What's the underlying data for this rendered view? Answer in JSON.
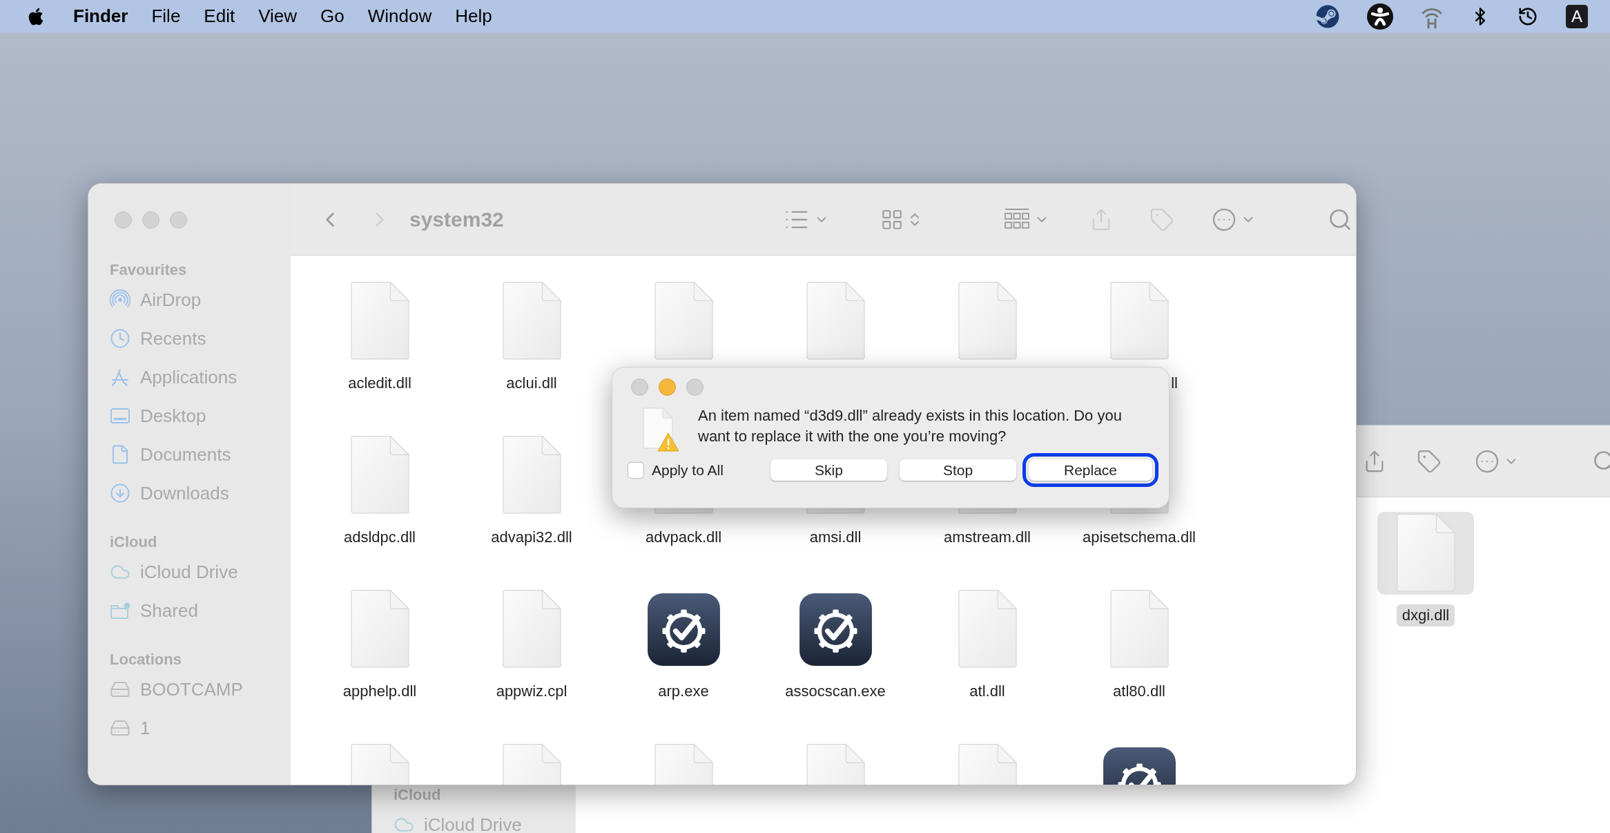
{
  "menu_bar": {
    "app_name": "Finder",
    "menus": [
      "File",
      "Edit",
      "View",
      "Go",
      "Window",
      "Help"
    ],
    "input_source": "A"
  },
  "back_window": {
    "sidebar": [
      {
        "heading": "iCloud",
        "items": [
          {
            "label": "iCloud Drive",
            "kind": "cloud",
            "selected": false
          }
        ]
      }
    ],
    "files": [
      {
        "label": "dxgi.dll",
        "kind": "document",
        "selected": true
      }
    ]
  },
  "finder_window": {
    "traffic_lights": [
      {
        "active": false
      },
      {
        "active": false
      },
      {
        "active": false
      }
    ],
    "back_enabled": true,
    "forward_enabled": false,
    "title": "system32",
    "sidebar": [
      {
        "heading": "Favourites",
        "items": [
          {
            "label": "AirDrop",
            "kind": "airdrop",
            "selected": false
          },
          {
            "label": "Recents",
            "kind": "clock",
            "selected": false
          },
          {
            "label": "Applications",
            "kind": "apps",
            "selected": false
          },
          {
            "label": "Desktop",
            "kind": "desktop",
            "selected": false
          },
          {
            "label": "Documents",
            "kind": "document",
            "selected": false
          },
          {
            "label": "Downloads",
            "kind": "download",
            "selected": false
          }
        ]
      },
      {
        "heading": "iCloud",
        "items": [
          {
            "label": "iCloud Drive",
            "kind": "cloud",
            "selected": false
          },
          {
            "label": "Shared",
            "kind": "shared",
            "selected": false
          }
        ]
      },
      {
        "heading": "Locations",
        "items": [
          {
            "label": "BOOTCAMP",
            "kind": "drive",
            "selected": false
          },
          {
            "label": "1",
            "kind": "drive",
            "selected": false
          }
        ]
      }
    ],
    "files": [
      {
        "label": "acledit.dll",
        "kind": "document",
        "selected": false
      },
      {
        "label": "aclui.dll",
        "kind": "document",
        "selected": false
      },
      {
        "kind": "document",
        "selected": false
      },
      {
        "kind": "document",
        "selected": false
      },
      {
        "kind": "document",
        "selected": false
      },
      {
        "label": "ll",
        "label_cut_left": true,
        "kind": "document",
        "selected": false
      },
      {
        "label": "adsldpc.dll",
        "kind": "document",
        "selected": false
      },
      {
        "label": "advapi32.dll",
        "kind": "document",
        "selected": false
      },
      {
        "label": "advpack.dll",
        "kind": "document",
        "selected": false
      },
      {
        "label": "amsi.dll",
        "kind": "document",
        "selected": false
      },
      {
        "label": "amstream.dll",
        "kind": "document",
        "selected": false
      },
      {
        "label": "apisetschema.dll",
        "kind": "document",
        "selected": false
      },
      {
        "label": "apphelp.dll",
        "kind": "document",
        "selected": false
      },
      {
        "label": "appwiz.cpl",
        "kind": "document",
        "selected": false
      },
      {
        "label": "arp.exe",
        "kind": "app",
        "selected": false
      },
      {
        "label": "assocscan.exe",
        "kind": "app",
        "selected": false
      },
      {
        "label": "atl.dll",
        "kind": "document",
        "selected": false
      },
      {
        "label": "atl80.dll",
        "kind": "document",
        "selected": false
      },
      {
        "kind": "document",
        "selected": false
      },
      {
        "kind": "document",
        "selected": false
      },
      {
        "kind": "document",
        "selected": false
      },
      {
        "kind": "document",
        "selected": false
      },
      {
        "kind": "document",
        "selected": false
      },
      {
        "kind": "app",
        "selected": false
      }
    ]
  },
  "dialog": {
    "traffic_lights": [
      {
        "kind": "close",
        "active": false
      },
      {
        "kind": "minimize",
        "active": true
      },
      {
        "kind": "zoom",
        "active": false
      }
    ],
    "message": "An item named “d3d9.dll” already exists in this location. Do you want to replace it with the one you’re moving?",
    "apply_to_all": {
      "label": "Apply to All",
      "checked": false
    },
    "buttons": [
      {
        "label": "Skip",
        "focused": false
      },
      {
        "label": "Stop",
        "focused": false
      },
      {
        "label": "Replace",
        "focused": true
      }
    ]
  }
}
